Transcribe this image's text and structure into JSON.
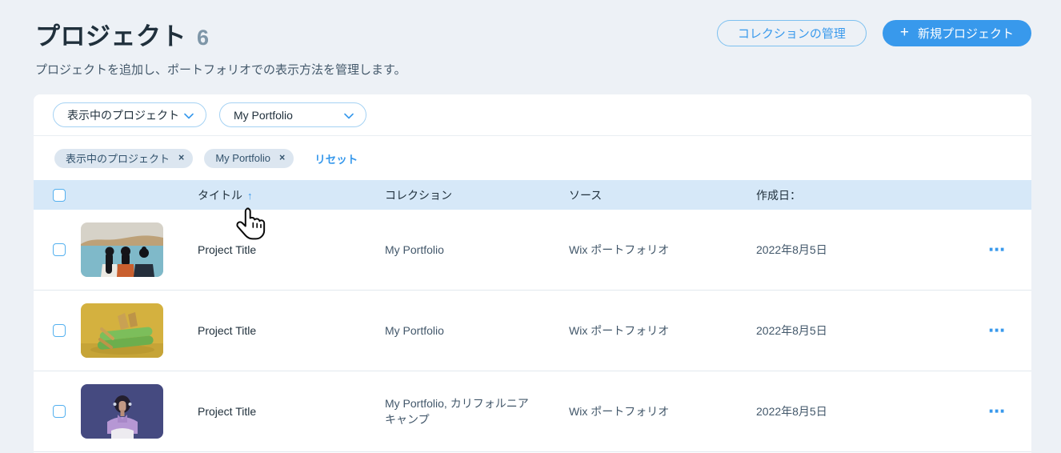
{
  "colors": {
    "accent_blue": "#3899EC",
    "table_header_bg": "#D6E8F8",
    "chip_bg": "#DCE6F0",
    "page_bg": "#EDF1F6"
  },
  "page": {
    "title": "プロジェクト",
    "count": "6",
    "subtitle": "プロジェクトを追加し、ポートフォリオでの表示方法を管理します。",
    "actions": {
      "manage_collections": "コレクションの管理",
      "plus": "+",
      "new_project": "新規プロジェクト"
    }
  },
  "filters": {
    "dropdowns": [
      {
        "label": "表示中のプロジェクト"
      },
      {
        "label": "My Portfolio"
      }
    ],
    "chips": [
      {
        "label": "表示中のプロジェクト"
      },
      {
        "label": "My Portfolio"
      }
    ],
    "close_icon": "×",
    "reset": "リセット"
  },
  "table": {
    "headers": {
      "title": "タイトル",
      "sort_arrow": "↑",
      "collection": "コレクション",
      "source": "ソース",
      "created": "作成日："
    },
    "menu_icon": "⋯",
    "rows": [
      {
        "title": "Project Title",
        "collection": "My Portfolio",
        "source": "Wix ポートフォリオ",
        "created": "2022年8月5日",
        "thumbnail": "lake-three-people"
      },
      {
        "title": "Project Title",
        "collection": "My Portfolio",
        "source": "Wix ポートフォリオ",
        "created": "2022年8月5日",
        "thumbnail": "yellow-green-legs-sandals"
      },
      {
        "title": "Project Title",
        "collection": "My Portfolio, カリフォルニアキャンプ",
        "source": "Wix ポートフォリオ",
        "created": "2022年8月5日",
        "thumbnail": "purple-portrait"
      }
    ]
  }
}
